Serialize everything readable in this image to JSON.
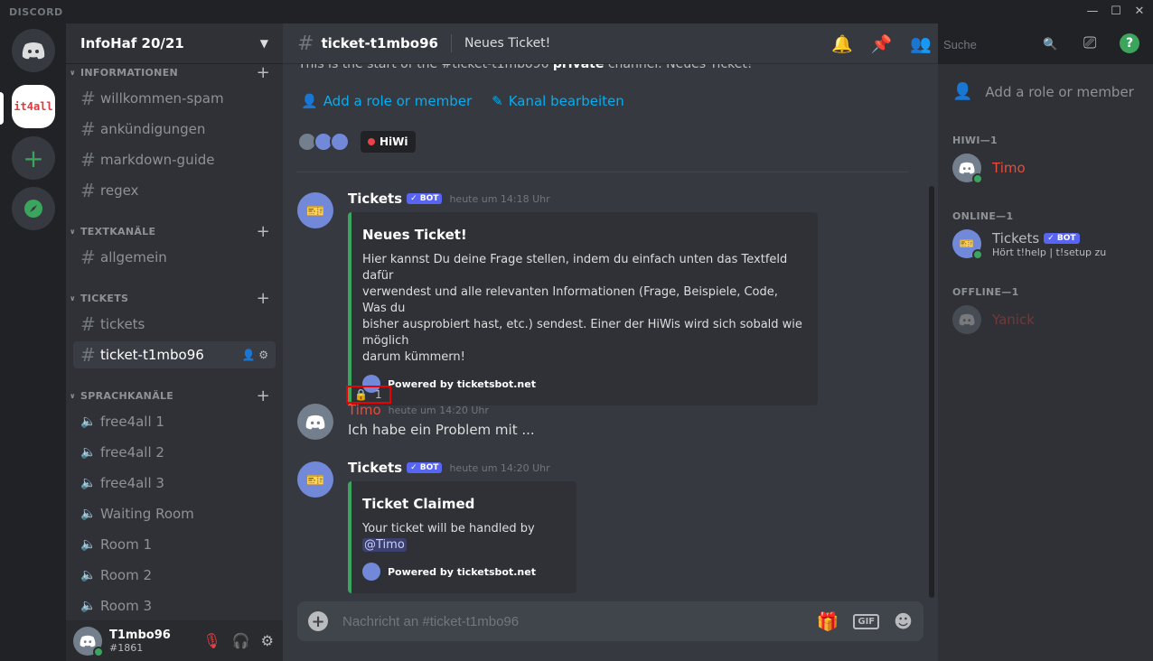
{
  "window": {
    "brand": "DISCORD"
  },
  "servers": [
    {
      "name": "home"
    },
    {
      "name": "it4all",
      "label": "it4all"
    },
    {
      "name": "add-server"
    },
    {
      "name": "explore"
    }
  ],
  "guild": {
    "name": "InfoHaf 20/21"
  },
  "categories": {
    "info": "INFORMATIONEN",
    "text": "TEXTKANÄLE",
    "tickets": "TICKETS",
    "voice": "SPRACHKANÄLE"
  },
  "channels": {
    "info": [
      "willkommen-spam",
      "ankündigungen",
      "markdown-guide",
      "regex"
    ],
    "text": [
      "allgemein"
    ],
    "tickets": [
      "tickets",
      "ticket-t1mbo96"
    ],
    "voice": [
      "free4all 1",
      "free4all 2",
      "free4all 3",
      "Waiting Room",
      "Room 1",
      "Room 2",
      "Room 3"
    ]
  },
  "user": {
    "name": "T1mbo96",
    "tag": "#1861"
  },
  "chat": {
    "channel": "ticket-t1mbo96",
    "topic": "Neues Ticket!",
    "intro_start": "This is the start of the #ticket-t1mbo96 ",
    "intro_bold": "private",
    "intro_end": " channel. Neues Ticket!",
    "add_role": "Add a role or member",
    "edit_channel": "Kanal bearbeiten",
    "role_pill": "HiWi",
    "composer_placeholder": "Nachricht an #ticket-t1mbo96",
    "search_placeholder": "Suche"
  },
  "messages": [
    {
      "author": "Tickets",
      "bot": "✓ BOT",
      "time": "heute um 14:18 Uhr",
      "embed_title": "Neues Ticket!",
      "embed_lines": [
        "Hier kannst Du deine Frage stellen, indem du einfach unten das Textfeld dafür",
        "verwendest und alle relevanten Informationen (Frage, Beispiele, Code, Was du",
        "bisher ausprobiert hast, etc.) sendest. Einer der HiWis wird sich sobald wie möglich",
        "darum kümmern!"
      ],
      "footer": "Powered by ticketsbot.net",
      "reaction_emoji": "🔒",
      "reaction_count": "1"
    },
    {
      "author": "Timo",
      "time": "heute um 14:20 Uhr",
      "text": "Ich habe ein Problem mit ..."
    },
    {
      "author": "Tickets",
      "bot": "✓ BOT",
      "time": "heute um 14:20 Uhr",
      "embed_title": "Ticket Claimed",
      "embed_text": "Your ticket will be handled by ",
      "mention": "@Timo",
      "footer": "Powered by ticketsbot.net"
    }
  ],
  "members": {
    "add_role": "Add a role or member",
    "hiwi_header": "HIWI—1",
    "online_header": "ONLINE—1",
    "offline_header": "OFFLINE—1",
    "hiwi": [
      {
        "name": "Timo"
      }
    ],
    "online": [
      {
        "name": "Tickets",
        "bot": "✓ BOT",
        "status": "Hört t!help | t!setup zu"
      }
    ],
    "offline": [
      {
        "name": "Yanick"
      }
    ]
  },
  "colors": {
    "accent": "#5865f2",
    "online": "#3ba55d",
    "hiwi_role": "#e74c3c",
    "link": "#00aff4"
  }
}
